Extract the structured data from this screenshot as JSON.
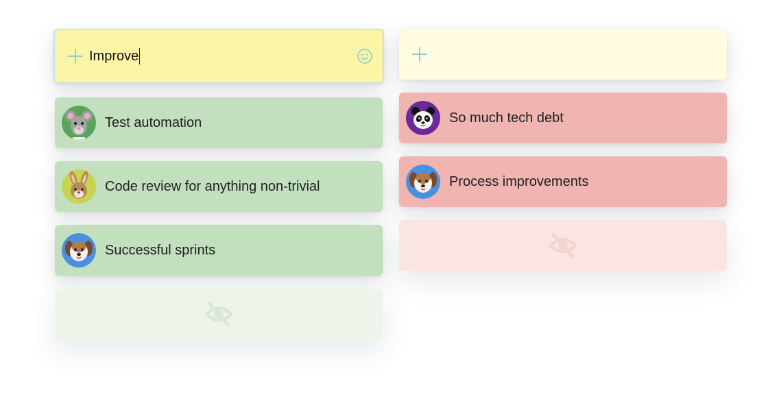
{
  "left_column": {
    "input": {
      "value": "Improve",
      "placeholder": ""
    },
    "notes": [
      {
        "text": "Test automation",
        "avatar": "mouse-avatar",
        "color": "#c2dfbe"
      },
      {
        "text": "Code review for anything non-trivial",
        "avatar": "rabbit-avatar",
        "color": "#c2dfbe"
      },
      {
        "text": "Successful sprints",
        "avatar": "dog-avatar",
        "color": "#c2dfbe"
      }
    ],
    "hidden_icon": "eye-off-icon"
  },
  "right_column": {
    "input": {
      "value": "",
      "placeholder": ""
    },
    "notes": [
      {
        "text": "So much tech debt",
        "avatar": "panda-avatar",
        "color": "#f0b5b0"
      },
      {
        "text": "Process improvements",
        "avatar": "dog-avatar",
        "color": "#f0b5b0"
      }
    ],
    "hidden_icon": "eye-off-icon"
  },
  "colors": {
    "input_active_bg": "#fdf5a6",
    "input_inactive_bg": "#fffce2",
    "accent": "#8fd0d4",
    "positive": "#c2dfbe",
    "negative": "#f0b5b0"
  }
}
